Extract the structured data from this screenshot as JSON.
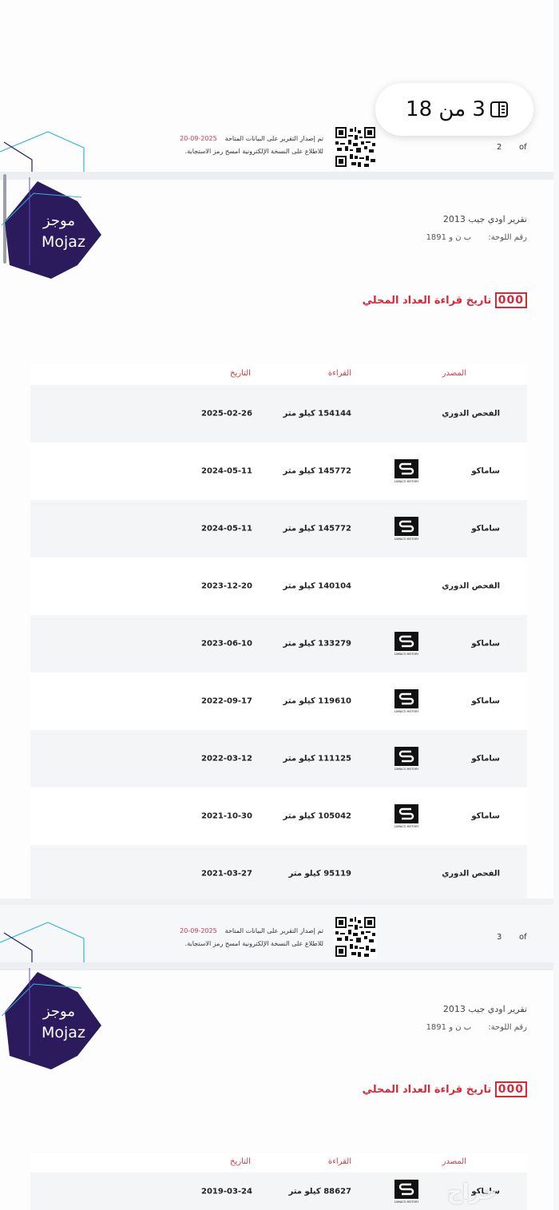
{
  "pager": {
    "current": "3",
    "sep": "من",
    "total": "18"
  },
  "footer1": {
    "line1": "تم إصدار التقرير على البيانات المتاحة",
    "date": "2025-09-20",
    "line2": "للاطلاع على النسخة الإلكترونية امسح رمز الاستجابة.",
    "of": "of",
    "page": "2"
  },
  "footer2": {
    "line1": "تم إصدار التقرير على البيانات المتاحة",
    "date": "2025-09-20",
    "line2": "للاطلاع على النسخة الإلكترونية امسح رمز الاستجابة.",
    "of": "of",
    "page": "3"
  },
  "logo": {
    "ar": "موجز",
    "en": "Mojaz"
  },
  "report": {
    "title": "تقرير اودي جيب 2013",
    "plate_label": "رقم اللوحة:",
    "plate_value": "ب ن و 1891"
  },
  "section": {
    "title": "تاريخ قراءة العداد المحلي",
    "odo": "000"
  },
  "table_headers": {
    "source": "المصدر",
    "reading": "القراءة",
    "date": "التاريخ"
  },
  "rows": [
    {
      "source": "الفحص الدوري",
      "reading": "154144 كيلو متر",
      "date": "2025-02-26"
    },
    {
      "source": "ساماكو",
      "reading": "145772 كيلو متر",
      "date": "2024-05-11"
    },
    {
      "source": "ساماكو",
      "reading": "145772 كيلو متر",
      "date": "2024-05-11"
    },
    {
      "source": "الفحص الدوري",
      "reading": "140104 كيلو متر",
      "date": "2023-12-20"
    },
    {
      "source": "ساماكو",
      "reading": "133279 كيلو متر",
      "date": "2023-06-10"
    },
    {
      "source": "ساماكو",
      "reading": "119610 كيلو متر",
      "date": "2022-09-17"
    },
    {
      "source": "ساماكو",
      "reading": "111125 كيلو متر",
      "date": "2022-03-12"
    },
    {
      "source": "ساماكو",
      "reading": "105042 كيلو متر",
      "date": "2021-10-30"
    },
    {
      "source": "الفحص الدوري",
      "reading": "95119 كيلو متر",
      "date": "2021-03-27"
    }
  ],
  "rows2": [
    {
      "source": "ساماكو",
      "reading": "88627 كيلو متر",
      "date": "2019-03-24"
    }
  ],
  "samaco_caption": "SAMACO MOTORS",
  "watermark": "حراج",
  "colors": {
    "accent_red": "#d42a3a",
    "logo_navy": "#2b1a5c",
    "logo_cyan": "#2bb8d6"
  },
  "icons": {
    "pager": "book-pages-icon",
    "qr": "qr-code-icon",
    "samaco": "samaco-logo-icon"
  }
}
